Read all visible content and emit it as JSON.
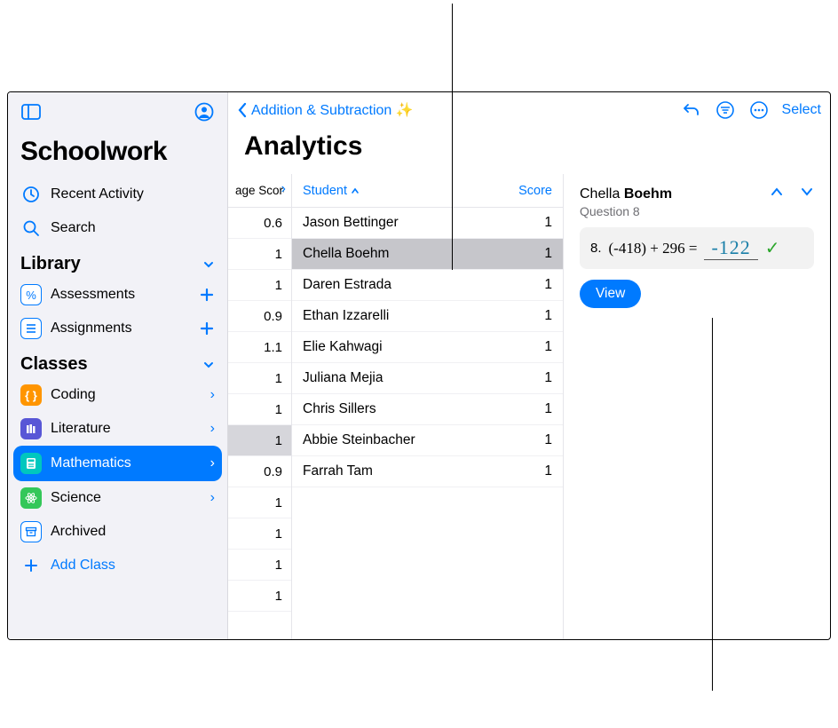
{
  "app": {
    "title": "Schoolwork"
  },
  "sidebar": {
    "recent": "Recent Activity",
    "search": "Search",
    "library_label": "Library",
    "assessments": "Assessments",
    "assignments": "Assignments",
    "classes_label": "Classes",
    "classes": {
      "coding": "Coding",
      "literature": "Literature",
      "mathematics": "Mathematics",
      "science": "Science",
      "archived": "Archived"
    },
    "add_class": "Add Class"
  },
  "main": {
    "back_label": "Addition & Subtraction ✨",
    "select_label": "Select",
    "title": "Analytics"
  },
  "scores_col": {
    "header": "age Score",
    "values": [
      "0.6",
      "1",
      "1",
      "0.9",
      "1.1",
      "1",
      "1",
      "1",
      "0.9",
      "1",
      "1",
      "1",
      "1"
    ],
    "selected_index": 7
  },
  "students_col": {
    "header_student": "Student",
    "header_score": "Score",
    "rows": [
      {
        "name": "Jason Bettinger",
        "score": "1"
      },
      {
        "name": "Chella Boehm",
        "score": "1"
      },
      {
        "name": "Daren Estrada",
        "score": "1"
      },
      {
        "name": "Ethan Izzarelli",
        "score": "1"
      },
      {
        "name": "Elie Kahwagi",
        "score": "1"
      },
      {
        "name": "Juliana Mejia",
        "score": "1"
      },
      {
        "name": "Chris Sillers",
        "score": "1"
      },
      {
        "name": "Abbie Steinbacher",
        "score": "1"
      },
      {
        "name": "Farrah Tam",
        "score": "1"
      }
    ],
    "selected_index": 1
  },
  "detail": {
    "name_first": "Chella",
    "name_last": "Boehm",
    "question_label": "Question 8",
    "qnum": "8.",
    "qtext": "(-418) + 296 =",
    "answer": "-122",
    "view": "View"
  }
}
